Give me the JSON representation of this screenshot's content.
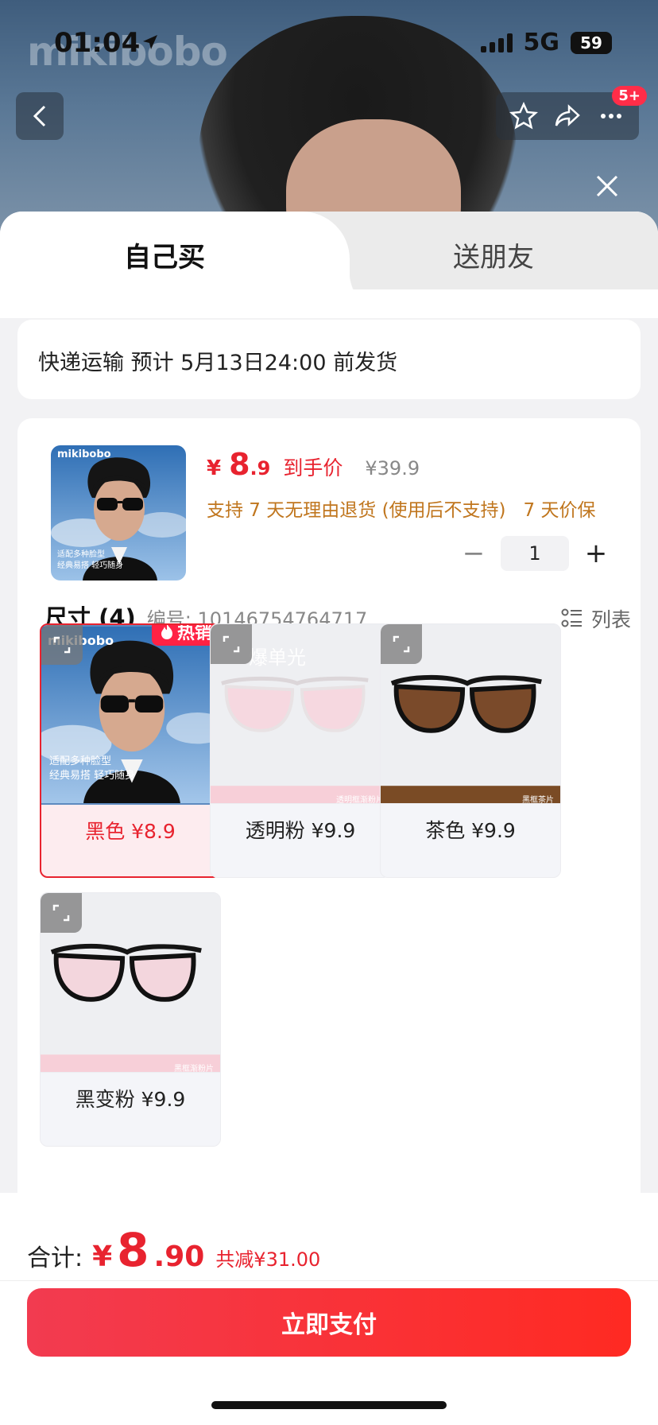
{
  "status": {
    "time": "01:04",
    "network": "5G",
    "battery": "59"
  },
  "bg": {
    "logo": "mikibobo"
  },
  "nav": {
    "badge": "5+"
  },
  "tabs": [
    {
      "label": "自己买"
    },
    {
      "label": "送朋友"
    }
  ],
  "shipping": {
    "text": "快递运输  预计 5月13日24:00 前发货"
  },
  "product": {
    "thumb_logo": "mikibobo",
    "thumb_caption_1": "适配多种脸型",
    "thumb_caption_2": "经典易搭 轻巧随身",
    "price_currency": "¥",
    "price_int": "8",
    "price_dec": ".9",
    "price_tag": "到手价",
    "price_original": "¥39.9",
    "service_1": "支持 7 天无理由退货 (使用后不支持)",
    "service_2": "7 天价保",
    "quantity": "1",
    "minus": "−",
    "plus": "+"
  },
  "spec": {
    "title": "尺寸 (4)",
    "code": "编号: 10146754764717",
    "list_label": "列表",
    "hot_badge": "热销",
    "watermark": "爆单光",
    "options": [
      {
        "label": "黑色 ¥8.9",
        "strip": ""
      },
      {
        "label": "透明粉 ¥9.9",
        "strip": "透明框渐粉片"
      },
      {
        "label": "茶色 ¥9.9",
        "strip": "黑框茶片"
      },
      {
        "label": "黑变粉 ¥9.9",
        "strip": "黑框渐粉片"
      }
    ]
  },
  "footer": {
    "total_label": "合计:",
    "total_currency": "¥",
    "total_int": "8",
    "total_dec": ".90",
    "total_save": "共减¥31.00",
    "pay_label": "立即支付"
  },
  "colors": {
    "accent": "#e8232f",
    "service": "#c0761e",
    "pay_start": "#f23b50",
    "pay_end": "#ff2a22"
  }
}
